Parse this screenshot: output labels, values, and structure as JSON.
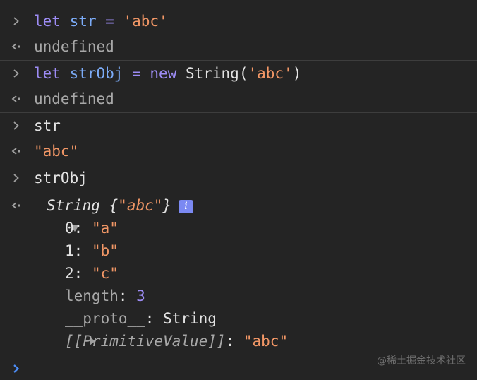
{
  "console": {
    "entries": [
      {
        "input": {
          "kw": "let",
          "var": "str",
          "op": " = ",
          "str": "'abc'"
        },
        "output": "undefined"
      },
      {
        "input": {
          "kw": "let",
          "var": "strObj",
          "op": " = ",
          "kw2": "new",
          "fn": " String(",
          "str": "'abc'",
          "close": ")"
        },
        "output": "undefined"
      },
      {
        "input": {
          "plain": "str"
        },
        "output": "\"abc\""
      },
      {
        "input": {
          "plain": "strObj"
        }
      }
    ],
    "object": {
      "type_label": "String",
      "preview_open": " {",
      "preview_value": "\"abc\"",
      "preview_close": "}",
      "info_badge": "i",
      "properties": [
        {
          "key": "0",
          "sep": ": ",
          "value": "\"a\""
        },
        {
          "key": "1",
          "sep": ": ",
          "value": "\"b\""
        },
        {
          "key": "2",
          "sep": ": ",
          "value": "\"c\""
        }
      ],
      "length_key": "length",
      "length_sep": ": ",
      "length_value": "3",
      "proto_key": "__proto__",
      "proto_sep": ": ",
      "proto_value": "String",
      "primitive_key": "[[PrimitiveValue]]",
      "primitive_sep": ": ",
      "primitive_value": "\"abc\""
    },
    "watermark": "@稀土掘金技术社区"
  },
  "colors": {
    "background": "#242424",
    "keyword": "#9d8cf5",
    "variable": "#7cacf8",
    "string": "#f29766",
    "muted": "#a8a8a8",
    "prompt": "#4d8df6"
  },
  "icons": {
    "input_prompt": "chevron-right-icon",
    "output_marker": "return-arrow-icon",
    "expand_open": "triangle-down-icon",
    "expand_closed": "triangle-right-icon",
    "active_prompt": "chevron-right-icon"
  }
}
